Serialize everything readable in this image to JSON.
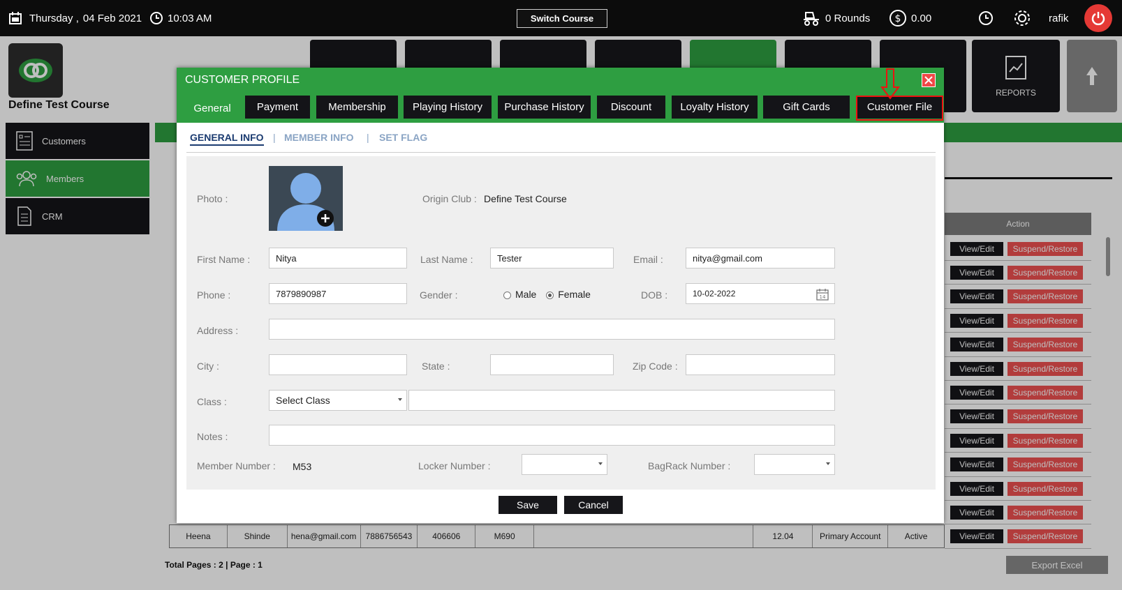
{
  "topbar": {
    "day": "Thursday ,",
    "date": "04 Feb 2021",
    "time": "10:03 AM",
    "switch_label": "Switch Course",
    "rounds": "0 Rounds",
    "balance": "0.00",
    "user": "rafik"
  },
  "brand": {
    "course_name": "Define Test Course"
  },
  "sidebar": {
    "items": [
      {
        "label": "Customers"
      },
      {
        "label": "Members"
      },
      {
        "label": "CRM"
      }
    ]
  },
  "nav": {
    "reports_label": "REPORTS"
  },
  "table": {
    "action_header": "Action",
    "view_label": "View/Edit",
    "suspend_label": "Suspend/Restore",
    "bottom_row": {
      "first": "Heena",
      "last": "Shinde",
      "email": "hena@gmail.com",
      "phone": "7886756543",
      "zip": "406606",
      "member": "M690",
      "amount": "12.04",
      "account": "Primary Account",
      "status": "Active"
    },
    "totals": "Total Pages : 2 | Page : 1",
    "export_label": "Export Excel"
  },
  "modal": {
    "title": "CUSTOMER PROFILE",
    "tabs": [
      {
        "label": "General"
      },
      {
        "label": "Payment"
      },
      {
        "label": "Membership"
      },
      {
        "label": "Playing History"
      },
      {
        "label": "Purchase History"
      },
      {
        "label": "Discount"
      },
      {
        "label": "Loyalty History"
      },
      {
        "label": "Gift Cards"
      },
      {
        "label": "Customer File"
      }
    ],
    "subtabs": [
      {
        "label": "GENERAL INFO"
      },
      {
        "label": "MEMBER INFO"
      },
      {
        "label": "SET FLAG"
      }
    ],
    "labels": {
      "photo": "Photo :",
      "origin": "Origin Club :",
      "first": "First Name :",
      "last": "Last Name :",
      "email": "Email :",
      "phone": "Phone :",
      "gender": "Gender :",
      "dob": "DOB :",
      "address": "Address :",
      "city": "City :",
      "state": "State :",
      "zip": "Zip Code :",
      "class": "Class :",
      "notes": "Notes :",
      "member_no": "Member Number :",
      "locker": "Locker Number :",
      "bagrack": "BagRack Number :",
      "male": "Male",
      "female": "Female"
    },
    "values": {
      "origin": "Define Test Course",
      "first": "Nitya",
      "last": "Tester",
      "email": "nitya@gmail.com",
      "phone": "7879890987",
      "dob": "10-02-2022",
      "class_select": "Select Class",
      "member_no": "M53"
    },
    "buttons": {
      "save": "Save",
      "cancel": "Cancel"
    }
  }
}
